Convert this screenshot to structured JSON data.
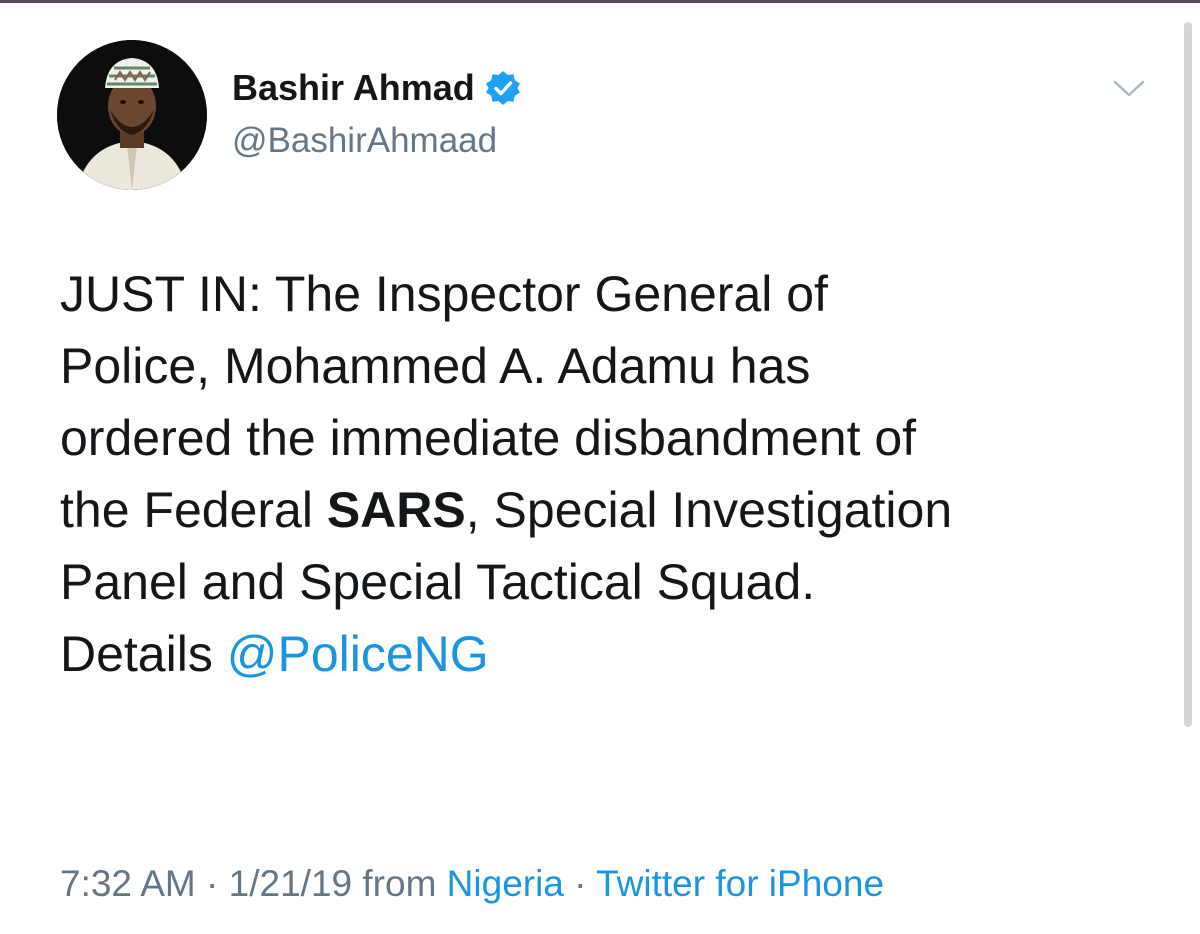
{
  "user": {
    "display_name": "Bashir Ahmad",
    "handle": "@BashirAhmaad",
    "verified": true,
    "avatar_icon": "profile-photo"
  },
  "menu": {
    "icon": "chevron-down-icon"
  },
  "tweet": {
    "lines": [
      {
        "text": "JUST IN: The Inspector General of"
      },
      {
        "text": "Police, Mohammed A. Adamu has"
      },
      {
        "text": "ordered the immediate disbandment of"
      },
      {
        "pre": "the Federal ",
        "bold": "SARS",
        "post": ", Special Investigation"
      },
      {
        "text": "Panel and Special Tactical Squad."
      },
      {
        "pre": "Details ",
        "mention": "@PoliceNG"
      }
    ]
  },
  "meta": {
    "time": "7:32 AM",
    "separator1": " · ",
    "date": "1/21/19",
    "from_label": " from ",
    "location": "Nigeria",
    "separator2": " · ",
    "source": "Twitter for iPhone"
  },
  "colors": {
    "link": "#1b95e0",
    "verified_badge": "#1da1f2",
    "secondary_text": "#657786"
  }
}
